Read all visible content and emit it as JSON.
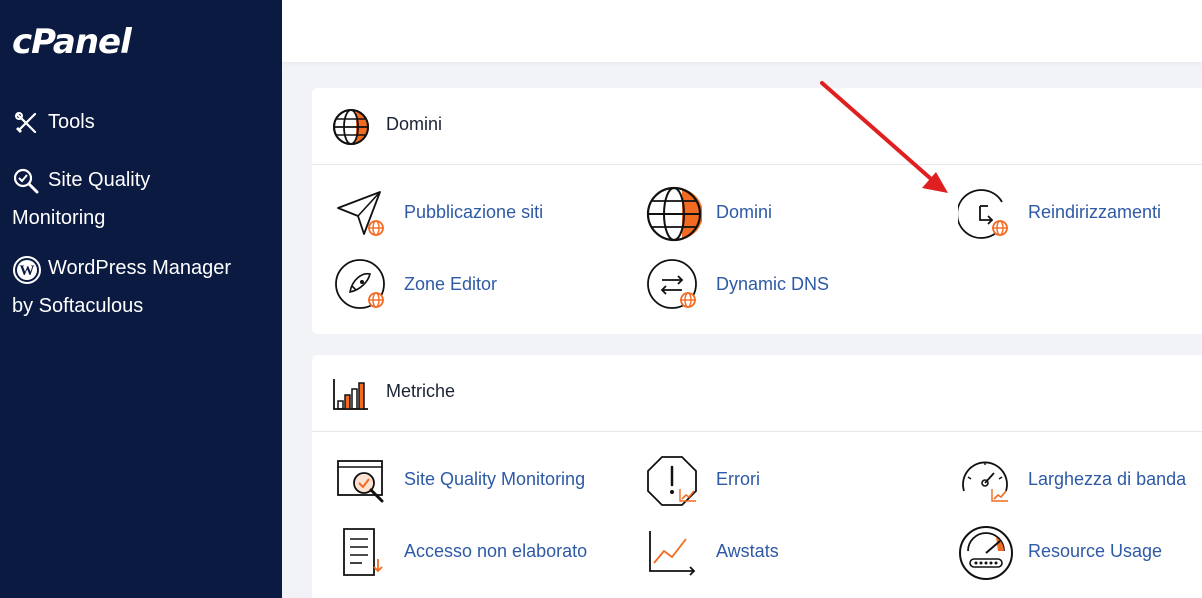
{
  "brand": {
    "logo_text": "cPanel"
  },
  "sidebar": {
    "items": [
      {
        "label": "Tools",
        "icon": "tools-icon"
      },
      {
        "label": "Site Quality",
        "label2": "Monitoring",
        "icon": "magnifier-check-icon"
      },
      {
        "label": "WordPress Manager",
        "label2": "by Softaculous",
        "icon": "wordpress-icon"
      }
    ]
  },
  "sections": {
    "domini": {
      "title": "Domini",
      "tools": [
        {
          "label": "Pubblicazione siti",
          "icon": "paper-plane-globe-icon"
        },
        {
          "label": "Domini",
          "icon": "globe-icon"
        },
        {
          "label": "Reindirizzamenti",
          "icon": "redirect-globe-icon"
        },
        {
          "label": "Zone Editor",
          "icon": "zone-editor-icon"
        },
        {
          "label": "Dynamic DNS",
          "icon": "dynamic-dns-icon"
        }
      ]
    },
    "metriche": {
      "title": "Metriche",
      "tools": [
        {
          "label": "Site Quality Monitoring",
          "icon": "site-quality-icon"
        },
        {
          "label": "Errori",
          "icon": "errors-icon"
        },
        {
          "label": "Larghezza di banda",
          "icon": "bandwidth-gauge-icon"
        },
        {
          "label": "Accesso non elaborato",
          "icon": "raw-access-icon"
        },
        {
          "label": "Awstats",
          "icon": "awstats-icon"
        },
        {
          "label": "Resource Usage",
          "icon": "resource-usage-icon"
        }
      ]
    }
  },
  "colors": {
    "sidebar_bg": "#0b1a41",
    "accent_orange": "#f26b21",
    "link_blue": "#2e5aa5",
    "annotation_arrow": "#e02020"
  }
}
